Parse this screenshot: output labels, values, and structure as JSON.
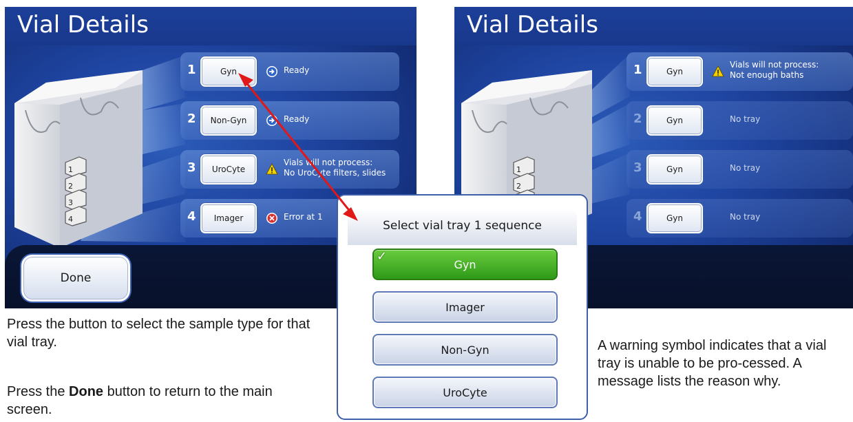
{
  "left_screen": {
    "title": "Vial Details",
    "rows": [
      {
        "num": "1",
        "sequence": "Gyn",
        "status_icon": "arrow-right-icon",
        "status": "Ready"
      },
      {
        "num": "2",
        "sequence": "Non-Gyn",
        "status_icon": "arrow-right-icon",
        "status": "Ready"
      },
      {
        "num": "3",
        "sequence": "UroCyte",
        "status_icon": "warning-icon",
        "status_line1": "Vials will not process:",
        "status_line2": "No UroCyte filters, slides"
      },
      {
        "num": "4",
        "sequence": "Imager",
        "status_icon": "error-x-icon",
        "status": "Error at 1"
      }
    ],
    "done_label": "Done",
    "tray_labels": [
      "1",
      "2",
      "3",
      "4"
    ]
  },
  "right_screen": {
    "title": "Vial Details",
    "rows": [
      {
        "num": "1",
        "sequence": "Gyn",
        "status_icon": "warning-icon",
        "status_line1": "Vials will not process:",
        "status_line2": "Not enough baths"
      },
      {
        "num": "2",
        "sequence": "Gyn",
        "status": "No tray"
      },
      {
        "num": "3",
        "sequence": "Gyn",
        "status": "No tray"
      },
      {
        "num": "4",
        "sequence": "Gyn",
        "status": "No tray"
      }
    ],
    "tray_labels": [
      "1",
      "2"
    ]
  },
  "popup": {
    "title": "Select vial tray 1 sequence",
    "options": [
      {
        "label": "Gyn",
        "selected": true
      },
      {
        "label": "Imager",
        "selected": false
      },
      {
        "label": "Non-Gyn",
        "selected": false
      },
      {
        "label": "UroCyte",
        "selected": false
      }
    ]
  },
  "captions": {
    "left_1": "Press the button to select the sample type for that vial tray.",
    "left_2_pre": "Press the ",
    "left_2_bold": "Done",
    "left_2_post": " button to return to the main screen.",
    "right_1": "A warning symbol indicates that a vial tray is unable to be pro-cessed. A message lists the reason why."
  },
  "colors": {
    "screen_blue": "#1e44a0",
    "selected_green": "#3faa22",
    "arrow_red": "#e01818",
    "warning_yellow": "#f5d000",
    "error_red": "#d83030"
  }
}
